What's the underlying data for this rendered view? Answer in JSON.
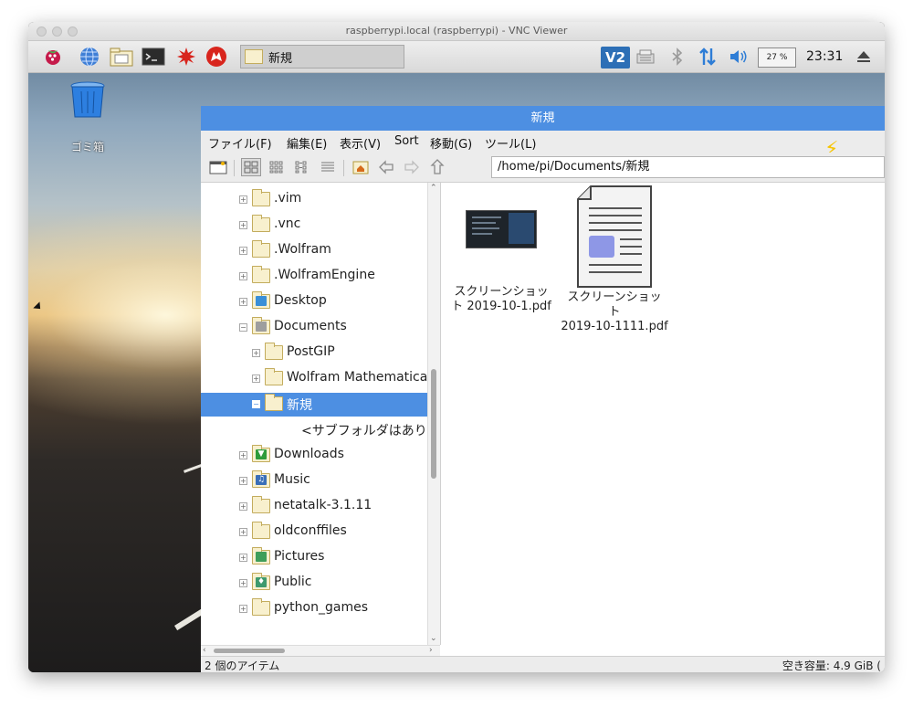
{
  "mac_window": {
    "title": "raspberrypi.local (raspberrypi) - VNC Viewer"
  },
  "taskbar": {
    "launchers": [
      "raspberry-menu-icon",
      "web-browser-icon",
      "file-manager-icon",
      "terminal-icon",
      "math-kernel-icon",
      "wolfram-icon"
    ],
    "task_button_label": "新規",
    "vnc_label": "V2",
    "cpu_usage": "27 %",
    "clock": "23:31"
  },
  "desktop": {
    "trash_label": "ゴミ箱"
  },
  "file_manager": {
    "title": "新規",
    "menu": [
      "ファイル(F)",
      "編集(E)",
      "表示(V)",
      "Sort",
      "移動(G)",
      "ツール(L)"
    ],
    "location": "/home/pi/Documents/新規",
    "tree": [
      {
        "label": ".vim",
        "type": "folder",
        "level": 0
      },
      {
        "label": ".vnc",
        "type": "folder",
        "level": 0
      },
      {
        "label": ".Wolfram",
        "type": "folder",
        "level": 0
      },
      {
        "label": ".WolframEngine",
        "type": "folder",
        "level": 0
      },
      {
        "label": "Desktop",
        "type": "desktop",
        "level": 0
      },
      {
        "label": "Documents",
        "type": "documents",
        "level": 0,
        "expanded": true
      },
      {
        "label": "PostGIP",
        "type": "folder",
        "level": 1
      },
      {
        "label": "Wolfram Mathematica",
        "type": "folder",
        "level": 1
      },
      {
        "label": "新規",
        "type": "folder",
        "level": 1,
        "selected": true,
        "expanded": true
      },
      {
        "label": "<サブフォルダはあり",
        "type": "none",
        "level": 2
      },
      {
        "label": "Downloads",
        "type": "downloads",
        "level": 0
      },
      {
        "label": "Music",
        "type": "music",
        "level": 0
      },
      {
        "label": "netatalk-3.1.11",
        "type": "folder",
        "level": 0
      },
      {
        "label": "oldconffiles",
        "type": "folder",
        "level": 0
      },
      {
        "label": "Pictures",
        "type": "pictures",
        "level": 0
      },
      {
        "label": "Public",
        "type": "public",
        "level": 0
      },
      {
        "label": "python_games",
        "type": "folder",
        "level": 0
      }
    ],
    "files": [
      {
        "line1": "スクリーンショッ",
        "line2": "ト 2019-10-1.pdf",
        "line3": ""
      },
      {
        "line1": "スクリーンショッ",
        "line2": "ト",
        "line3": "2019-10-1111.pdf"
      }
    ],
    "status": {
      "item_count": "2 個のアイテム",
      "free_space": "空き容量: 4.9 GiB ("
    }
  }
}
